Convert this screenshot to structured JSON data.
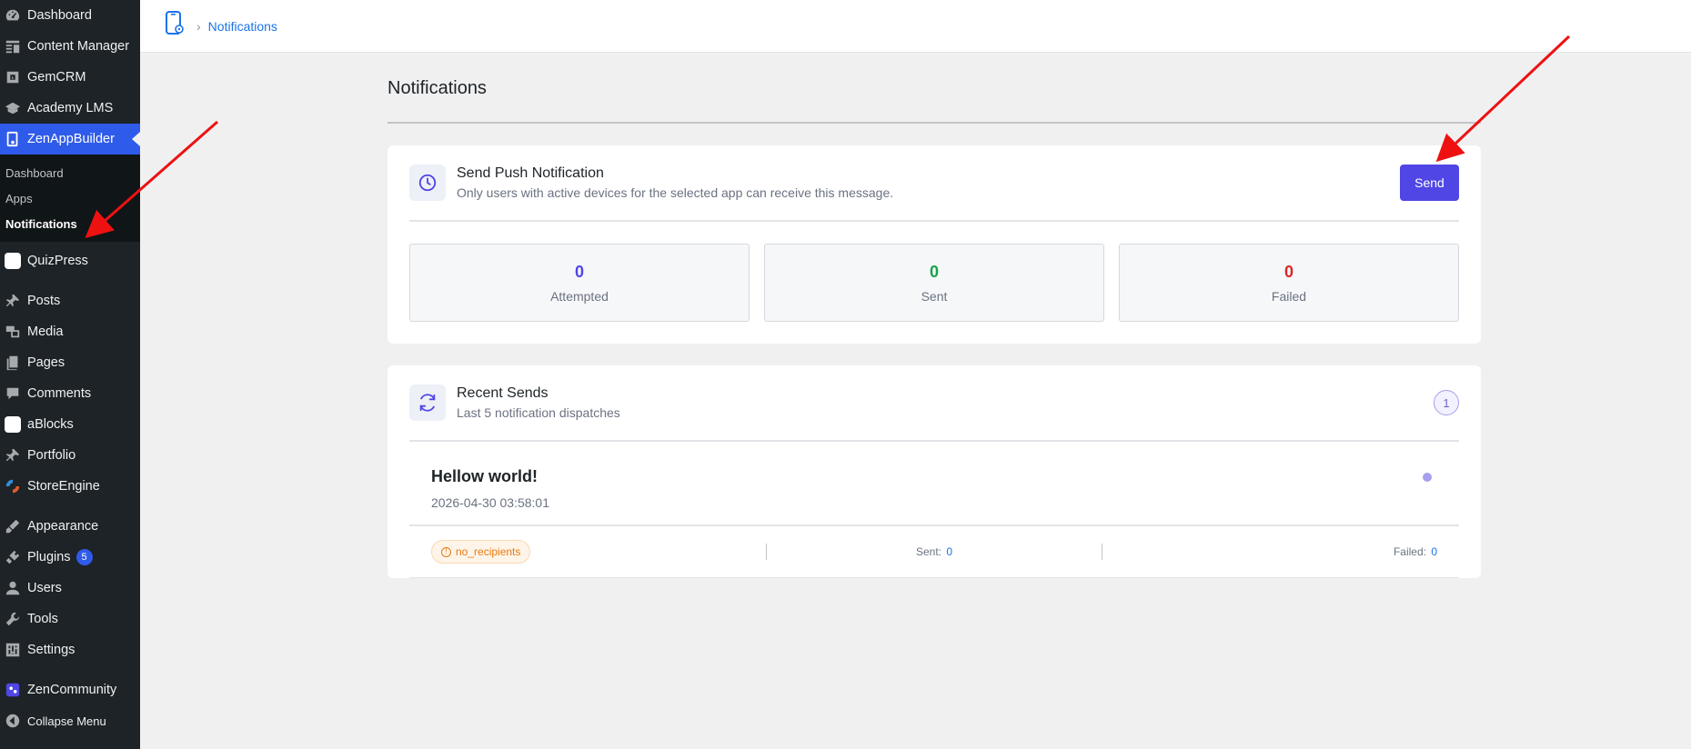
{
  "sidebar": {
    "items": [
      {
        "label": "Dashboard",
        "icon": "dashboard-icon"
      },
      {
        "label": "Content Manager",
        "icon": "content-manager-icon"
      },
      {
        "label": "GemCRM",
        "icon": "gemcrm-icon"
      },
      {
        "label": "Academy LMS",
        "icon": "academy-icon"
      },
      {
        "label": "ZenAppBuilder",
        "icon": "zenappbuilder-icon"
      },
      {
        "label": "QuizPress",
        "icon": "quizpress-icon"
      },
      {
        "label": "Posts",
        "icon": "pin-icon"
      },
      {
        "label": "Media",
        "icon": "media-icon"
      },
      {
        "label": "Pages",
        "icon": "pages-icon"
      },
      {
        "label": "Comments",
        "icon": "comments-icon"
      },
      {
        "label": "aBlocks",
        "icon": "ablocks-icon"
      },
      {
        "label": "Portfolio",
        "icon": "pin-icon"
      },
      {
        "label": "StoreEngine",
        "icon": "storeengine-icon"
      },
      {
        "label": "Appearance",
        "icon": "appearance-icon"
      },
      {
        "label": "Plugins",
        "icon": "plugins-icon",
        "badge": "5"
      },
      {
        "label": "Users",
        "icon": "users-icon"
      },
      {
        "label": "Tools",
        "icon": "tools-icon"
      },
      {
        "label": "Settings",
        "icon": "settings-icon"
      },
      {
        "label": "ZenCommunity",
        "icon": "zencommunity-icon"
      },
      {
        "label": "Collapse Menu",
        "icon": "collapse-icon"
      }
    ],
    "submenu": [
      {
        "label": "Dashboard"
      },
      {
        "label": "Apps"
      },
      {
        "label": "Notifications"
      }
    ]
  },
  "topbar": {
    "breadcrumb": "Notifications"
  },
  "main": {
    "title": "Notifications",
    "push_card": {
      "title": "Send Push Notification",
      "subtitle": "Only users with active devices for the selected app can receive this message.",
      "send_label": "Send",
      "stats": [
        {
          "value": "0",
          "label": "Attempted",
          "color": "#4f46e5"
        },
        {
          "value": "0",
          "label": "Sent",
          "color": "#16a34a"
        },
        {
          "value": "0",
          "label": "Failed",
          "color": "#dc2626"
        }
      ]
    },
    "recent_card": {
      "title": "Recent Sends",
      "subtitle": "Last 5 notification dispatches",
      "count": "1",
      "items": [
        {
          "title": "Hellow world!",
          "date": "2026-04-30 03:58:01",
          "status": "no_recipients",
          "sent_label": "Sent:",
          "sent": "0",
          "failed_label": "Failed:",
          "failed": "0"
        }
      ]
    }
  },
  "colors": {
    "accent": "#4f46e5",
    "wp_active": "#2f5bea",
    "annotation": "#ee1111"
  }
}
